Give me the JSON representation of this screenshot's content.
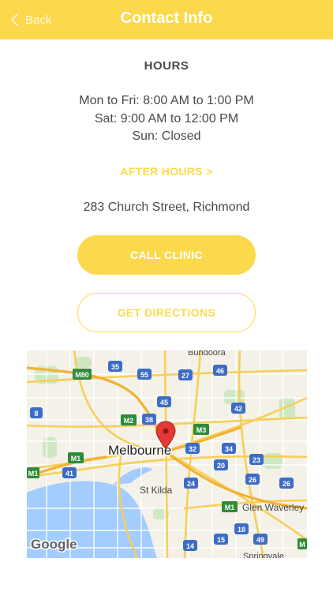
{
  "header": {
    "back_label": "Back",
    "title": "Contact Info"
  },
  "hours": {
    "heading": "HOURS",
    "lines": [
      "Mon to Fri: 8:00 AM to 1:00 PM",
      "Sat: 9:00 AM to 12:00 PM",
      "Sun: Closed"
    ]
  },
  "after_hours_label": "AFTER HOURS >",
  "address": "283 Church Street, Richmond",
  "buttons": {
    "call": "CALL CLINIC",
    "directions": "GET DIRECTIONS"
  },
  "map": {
    "city_label": "Melbourne",
    "suburbs": [
      "Bundoora",
      "St Kilda",
      "Glen Waverley",
      "Springvale"
    ],
    "route_shields": [
      "35",
      "55",
      "27",
      "46",
      "45",
      "42",
      "38",
      "32",
      "34",
      "20",
      "23",
      "24",
      "26",
      "26",
      "41",
      "8",
      "18",
      "15",
      "49",
      "14"
    ],
    "motorway_shields": [
      "M80",
      "M2",
      "M3",
      "M1",
      "M1",
      "M1",
      "M"
    ],
    "provider": "Google"
  },
  "colors": {
    "accent": "#fcd94c",
    "text": "#4a4a4a",
    "water": "#a3ccff",
    "pin": "#e53935"
  }
}
